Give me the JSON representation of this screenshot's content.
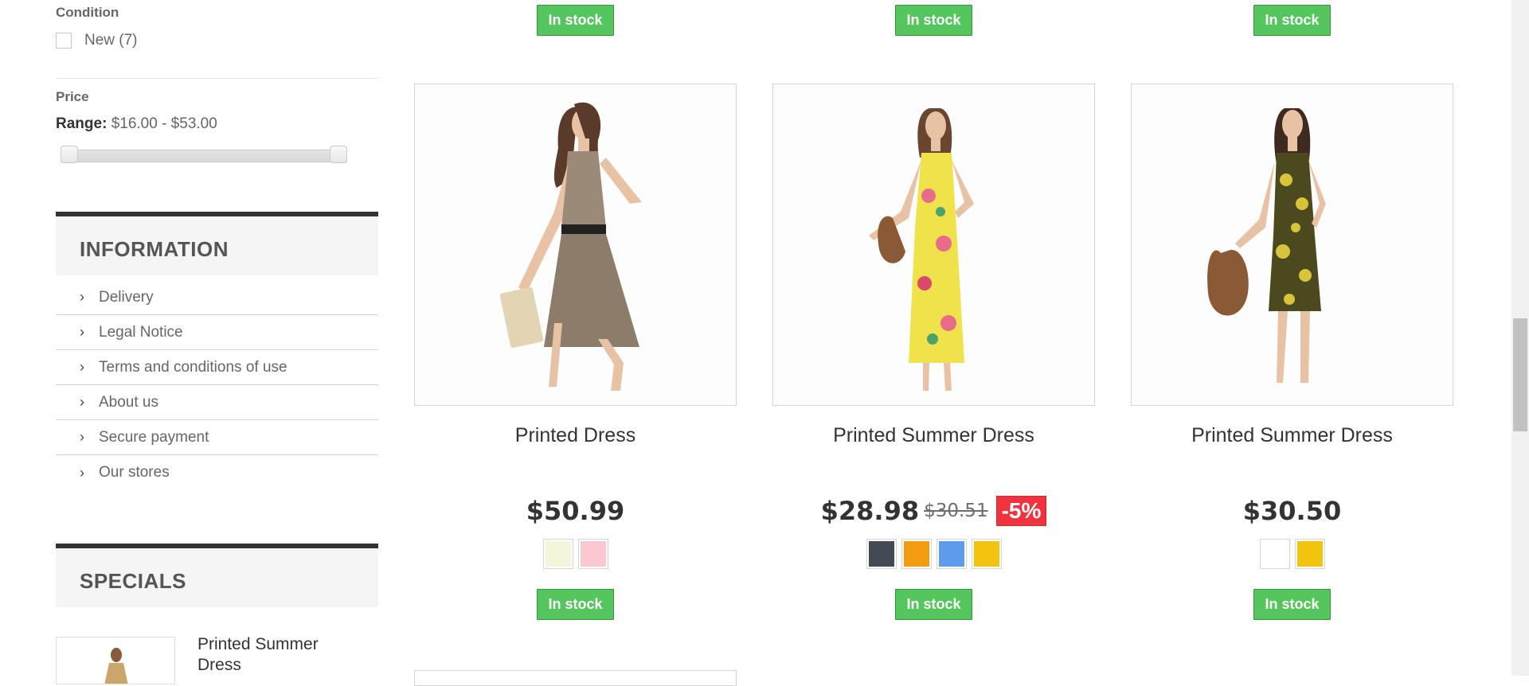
{
  "filters": {
    "condition": {
      "title": "Condition",
      "option": "New (7)"
    },
    "price": {
      "title": "Price",
      "range_label": "Range:",
      "range_value": "$16.00 - $53.00"
    }
  },
  "information": {
    "title": "INFORMATION",
    "links": [
      "Delivery",
      "Legal Notice",
      "Terms and conditions of use",
      "About us",
      "Secure payment",
      "Our stores"
    ]
  },
  "specials": {
    "title": "SPECIALS",
    "item_name": "Printed Summer Dress"
  },
  "stock_label": "In stock",
  "products": [
    {
      "name": "Printed Dress",
      "price": "$50.99",
      "colors": [
        "#f5f5dc",
        "#fcc8d0"
      ]
    },
    {
      "name": "Printed Summer Dress",
      "price": "$28.98",
      "old_price": "$30.51",
      "discount": "-5%",
      "colors": [
        "#434a54",
        "#f39c11",
        "#5d9cec",
        "#f1c40f"
      ]
    },
    {
      "name": "Printed Summer Dress",
      "price": "$30.50",
      "colors": [
        "#ffffff",
        "#f1c40f"
      ]
    }
  ]
}
